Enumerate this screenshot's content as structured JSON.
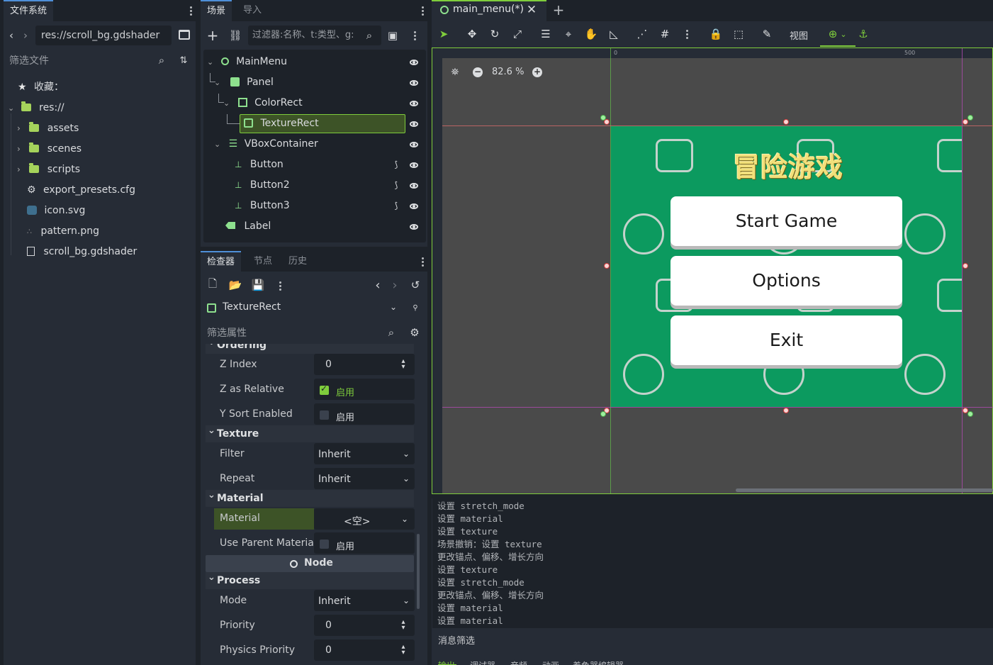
{
  "filesystem": {
    "tab_label": "文件系统",
    "path": "res://scroll_bg.gdshader",
    "filter_placeholder": "筛选文件",
    "favorites_label": "收藏：",
    "root_label": "res://",
    "folders": [
      "assets",
      "scenes",
      "scripts"
    ],
    "files": [
      "export_presets.cfg",
      "icon.svg",
      "pattern.png",
      "scroll_bg.gdshader"
    ]
  },
  "scene_panel": {
    "tab_scene": "场景",
    "tab_import": "导入",
    "filter_placeholder": "过滤器:名称、t:类型、g:",
    "nodes": [
      {
        "label": "MainMenu",
        "icon": "control-node-icon"
      },
      {
        "label": "Panel",
        "icon": "panel-icon"
      },
      {
        "label": "ColorRect",
        "icon": "colorrect-icon"
      },
      {
        "label": "TextureRect",
        "icon": "texturerect-icon"
      },
      {
        "label": "VBoxContainer",
        "icon": "vbox-icon"
      },
      {
        "label": "Button",
        "icon": "button-icon"
      },
      {
        "label": "Button2",
        "icon": "button-icon"
      },
      {
        "label": "Button3",
        "icon": "button-icon"
      },
      {
        "label": "Label",
        "icon": "label-icon"
      }
    ]
  },
  "inspector": {
    "tab_inspector": "检查器",
    "tab_node": "节点",
    "tab_history": "历史",
    "object_name": "TextureRect",
    "filter_placeholder": "筛选属性",
    "section_ordering": "Ordering",
    "z_index_label": "Z Index",
    "z_index_value": "0",
    "z_relative_label": "Z as Relative",
    "enabled_text": "启用",
    "y_sort_label": "Y Sort Enabled",
    "section_texture": "Texture",
    "filter_label": "Filter",
    "filter_value": "Inherit",
    "repeat_label": "Repeat",
    "repeat_value": "Inherit",
    "section_material": "Material",
    "material_label": "Material",
    "material_value": "<空>",
    "use_parent_label": "Use Parent Materia",
    "node_category": "Node",
    "section_process": "Process",
    "mode_label": "Mode",
    "mode_value": "Inherit",
    "priority_label": "Priority",
    "priority_value": "0",
    "physics_priority_label": "Physics Priority",
    "physics_priority_value": "0"
  },
  "editor": {
    "scene_tab": "main_menu(*)",
    "view_menu": "视图",
    "zoom": "82.6 %",
    "ruler_0": "0",
    "ruler_500": "500"
  },
  "game": {
    "title": "冒险游戏",
    "buttons": [
      "Start Game",
      "Options",
      "Exit"
    ]
  },
  "output": {
    "lines": [
      "设置 stretch_mode",
      "设置 material",
      "设置 texture",
      "场景撤销：设置 texture",
      "更改锚点、偏移、增长方向",
      "设置 texture",
      "设置 stretch_mode",
      "更改锚点、偏移、增长方向",
      "设置 material",
      "设置 material"
    ],
    "filter_placeholder": "消息筛选",
    "bottom_tabs": [
      "输出",
      "调试器",
      "音频",
      "动画",
      "着色器编辑器"
    ]
  },
  "colors": {
    "accent": "#7fcd3c",
    "game_bg": "#0c9a5f",
    "selection": "#3d5327"
  }
}
